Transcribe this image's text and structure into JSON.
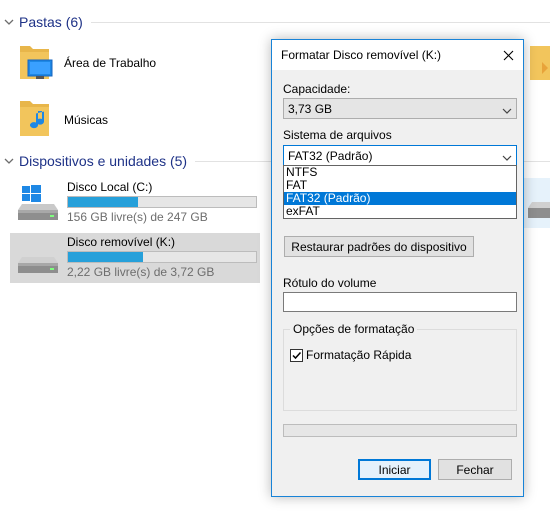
{
  "explorer": {
    "folders_group": {
      "title": "Pastas (6)"
    },
    "folders": [
      {
        "label": "Área de Trabalho",
        "icon": "desktop-folder-icon"
      },
      {
        "label": "Músicas",
        "icon": "music-folder-icon"
      }
    ],
    "devices_group": {
      "title": "Dispositivos e unidades (5)"
    },
    "drives": [
      {
        "name": "Disco Local (C:)",
        "free": "156 GB livre(s) de 247 GB",
        "used_fraction": 0.37,
        "icon": "windows-drive-icon"
      },
      {
        "name": "Disco removível (K:)",
        "free": "2,22 GB livre(s) de 3,72 GB",
        "used_fraction": 0.4,
        "icon": "removable-drive-icon"
      }
    ]
  },
  "dialog": {
    "title": "Formatar Disco removível (K:)",
    "capacity_label": "Capacidade:",
    "capacity_value": "3,73 GB",
    "filesystem_label": "Sistema de arquivos",
    "filesystem_value": "FAT32 (Padrão)",
    "filesystem_options": [
      "NTFS",
      "FAT",
      "FAT32 (Padrão)",
      "exFAT"
    ],
    "filesystem_selected_index": 2,
    "restore_button": "Restaurar padrões do dispositivo",
    "volume_label": "Rótulo do volume",
    "volume_value": "",
    "options_group": "Opções de formatação",
    "quick_format_label": "Formatação Rápida",
    "quick_format_checked": true,
    "start_button": "Iniciar",
    "close_button": "Fechar",
    "progress": 0
  },
  "colors": {
    "accent": "#0078d7",
    "group_title": "#1e3287",
    "drive_bar": "#26a0da",
    "folder": "#f2c55c"
  }
}
